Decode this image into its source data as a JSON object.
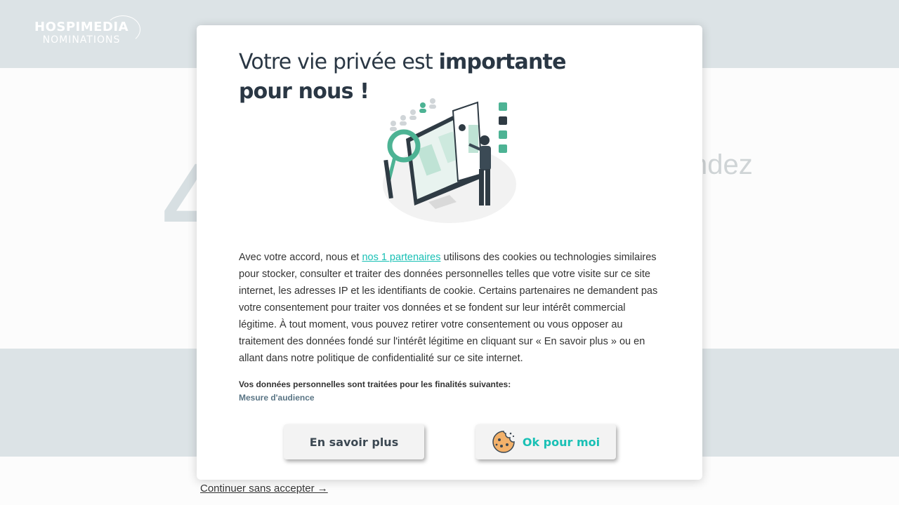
{
  "background": {
    "logo_line1": "HOSPIMEDIA",
    "logo_line2": "NOMINATIONS",
    "big_char": "4",
    "partial_word": "ndez"
  },
  "modal": {
    "title_light": "Votre vie privée est ",
    "title_bold": "importante pour nous !",
    "body_before_link": "Avec votre accord, nous et ",
    "partners_link": "nos 1 partenaires",
    "body_after_link": " utilisons des cookies ou technologies similaires pour stocker, consulter et traiter des données personnelles telles que votre visite sur ce site internet, les adresses IP et les identifiants de cookie. Certains partenaires ne demandent pas votre consentement pour traiter vos données et se fondent sur leur intérêt commercial légitime. À tout moment, vous pouvez retirer votre consentement ou vous opposer au traitement des données fondé sur l'intérêt légitime en cliquant sur « En savoir plus » ou en allant dans notre politique de confidentialité sur ce site internet.",
    "purposes_title": "Vos données personnelles sont traitées pour les finalités suivantes:",
    "purposes": [
      "Mesure d'audience"
    ],
    "btn_more": "En savoir plus",
    "btn_ok": "Ok pour moi"
  },
  "continue_link": "Continuer sans accepter →",
  "colors": {
    "accent": "#19c0b5",
    "title": "#2a3744",
    "header_bg": "#dce3e6"
  }
}
